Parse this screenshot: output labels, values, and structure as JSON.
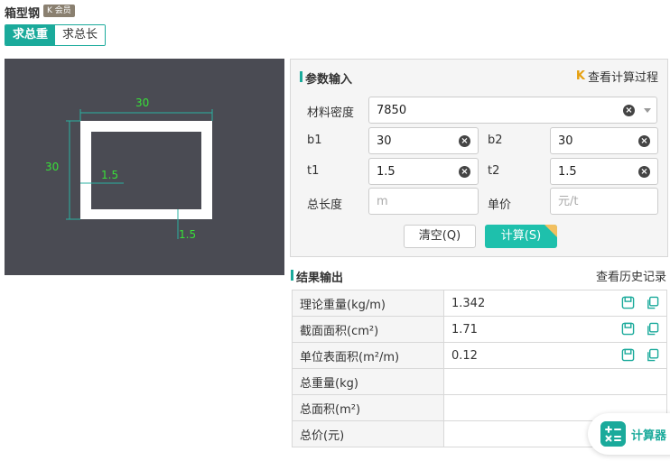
{
  "header": {
    "title": "箱型钢",
    "vip_badge": "会员"
  },
  "tabs": [
    {
      "label": "求总重",
      "active": true
    },
    {
      "label": "求总长",
      "active": false
    }
  ],
  "drawing": {
    "dim_b1": "30",
    "dim_b2": "30",
    "dim_t1": "1.5",
    "dim_t2": "1.5"
  },
  "params": {
    "title": "参数输入",
    "view_process": "查看计算过程",
    "density": {
      "label": "材料密度",
      "value": "7850"
    },
    "b1": {
      "label": "b1",
      "value": "30"
    },
    "b2": {
      "label": "b2",
      "value": "30"
    },
    "t1": {
      "label": "t1",
      "value": "1.5"
    },
    "t2": {
      "label": "t2",
      "value": "1.5"
    },
    "total_length": {
      "label": "总长度",
      "placeholder": "m"
    },
    "unit_price": {
      "label": "单价",
      "placeholder": "元/t"
    },
    "clear_button": "清空(Q)",
    "calc_button": "计算(S)"
  },
  "results": {
    "title": "结果输出",
    "history_link": "查看历史记录",
    "rows": [
      {
        "label": "理论重量(kg/m)",
        "value": "1.342"
      },
      {
        "label": "截面面积(cm²)",
        "value": "1.71"
      },
      {
        "label": "单位表面积(m²/m)",
        "value": "0.12"
      },
      {
        "label": "总重量(kg)",
        "value": ""
      },
      {
        "label": "总面积(m²)",
        "value": ""
      },
      {
        "label": "总价(元)",
        "value": ""
      }
    ]
  },
  "fab": {
    "label": "计算器"
  },
  "colors": {
    "accent": "#1aaa9b",
    "button": "#1ec0ac",
    "canvas": "#4a4b53",
    "dimension": "#38e038"
  },
  "icons": [
    "vip-k-icon",
    "clear-icon",
    "dropdown-caret-icon",
    "process-k-icon",
    "save-icon",
    "copy-icon",
    "calculator-icon"
  ]
}
